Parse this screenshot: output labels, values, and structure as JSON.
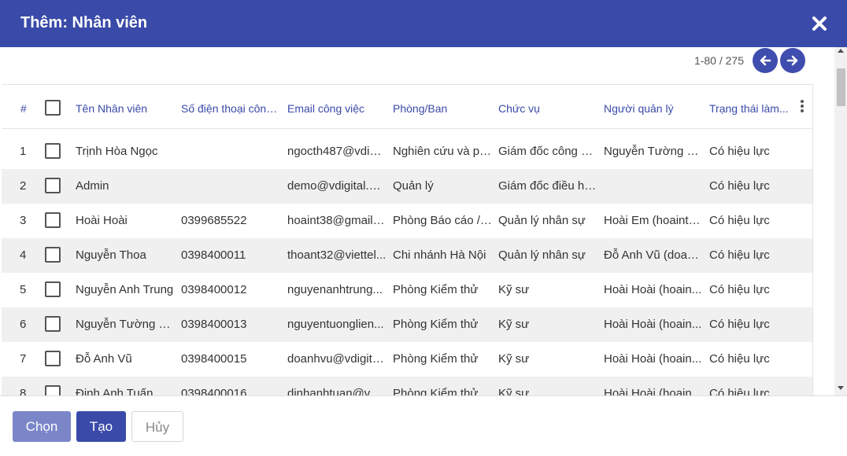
{
  "dialog": {
    "title": "Thêm: Nhân viên",
    "close_icon": "close-icon"
  },
  "pager": {
    "text": "1-80 / 275",
    "prev_icon": "arrow-left-icon",
    "next_icon": "arrow-right-icon"
  },
  "table": {
    "columns": {
      "index": "#",
      "name": "Tên Nhân viên",
      "phone": "Số điện thoại công...",
      "email": "Email công việc",
      "department": "Phòng/Ban",
      "position": "Chức vụ",
      "manager": "Người quản lý",
      "status": "Trạng thái làm..."
    },
    "rows": [
      {
        "index": "1",
        "name": "Trịnh Hòa Ngọc",
        "phone": "",
        "email": "ngocth487@vdigital...",
        "department": "Nghiên cứu và phá...",
        "position": "Giám đốc công ng...",
        "manager": "Nguyễn Tường Li...",
        "status": "Có hiệu lực"
      },
      {
        "index": "2",
        "name": "Admin",
        "phone": "",
        "email": "demo@vdigital.com...",
        "department": "Quản lý",
        "position": "Giám đốc điều hành",
        "manager": "",
        "status": "Có hiệu lực"
      },
      {
        "index": "3",
        "name": "Hoài Hoài",
        "phone": "0399685522",
        "email": "hoaint38@gmail.com",
        "department": "Phòng Báo cáo / ...",
        "position": "Quản lý nhân sự",
        "manager": "Hoài Em (hoaint3...",
        "status": "Có hiệu lực"
      },
      {
        "index": "4",
        "name": "Nguyễn Thoa",
        "phone": "0398400011",
        "email": "thoant32@viettel...",
        "department": "Chi nhánh Hà Nội",
        "position": "Quản lý nhân sự",
        "manager": "Đỗ Anh Vũ (doan...",
        "status": "Có hiệu lực"
      },
      {
        "index": "5",
        "name": "Nguyễn Anh Trung",
        "phone": "0398400012",
        "email": "nguyenanhtrung...",
        "department": "Phòng Kiểm thử",
        "position": "Kỹ sư",
        "manager": "Hoài Hoài (hoain...",
        "status": "Có hiệu lực"
      },
      {
        "index": "6",
        "name": "Nguyễn Tường Li...",
        "phone": "0398400013",
        "email": "nguyentuonglien...",
        "department": "Phòng Kiểm thử",
        "position": "Kỹ sư",
        "manager": "Hoài Hoài (hoain...",
        "status": "Có hiệu lực"
      },
      {
        "index": "7",
        "name": "Đỗ Anh Vũ",
        "phone": "0398400015",
        "email": "doanhvu@vdigital...",
        "department": "Phòng Kiểm thử",
        "position": "Kỹ sư",
        "manager": "Hoài Hoài (hoain...",
        "status": "Có hiệu lực"
      },
      {
        "index": "8",
        "name": "Đinh Anh Tuấn",
        "phone": "0398400016",
        "email": "dinhanhtuan@vdi...",
        "department": "Phòng Kiểm thử",
        "position": "Kỹ sư",
        "manager": "Hoài Hoài (hoain...",
        "status": "Có hiệu lực"
      }
    ]
  },
  "footer": {
    "choose_label": "Chọn",
    "create_label": "Tạo",
    "cancel_label": "Hủy"
  },
  "colors": {
    "primary": "#3a4aa8",
    "primary_light": "#7b86c9",
    "row_stripe": "#f0f0f0"
  }
}
